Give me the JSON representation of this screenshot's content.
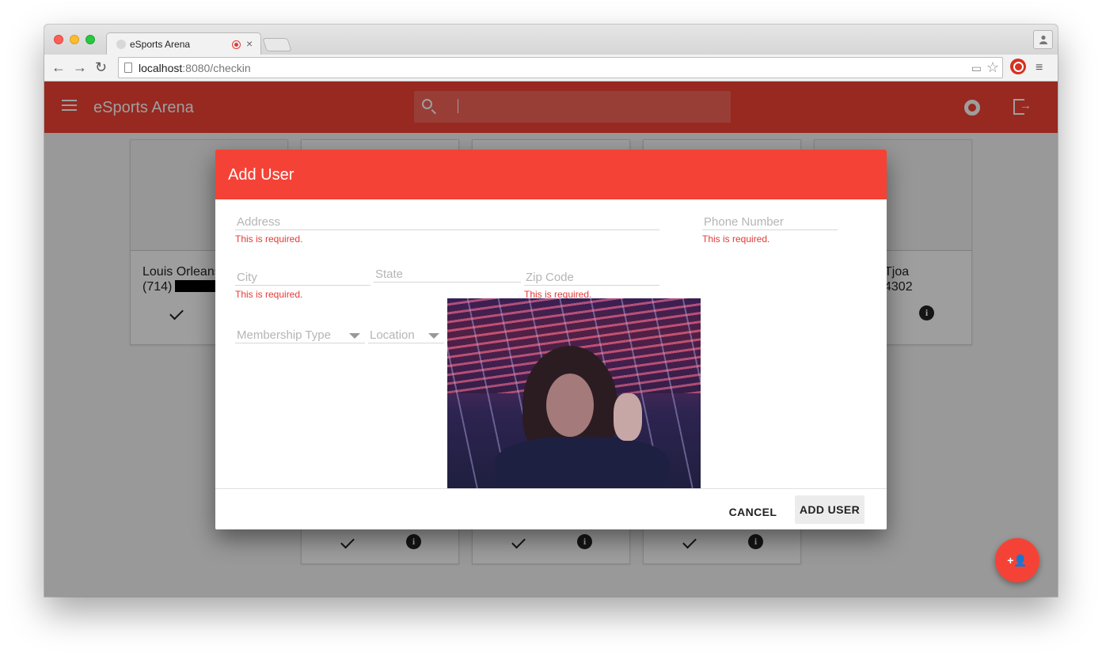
{
  "browser": {
    "tab_title": "eSports Arena",
    "url_host": "localhost",
    "url_path": ":8080/checkin"
  },
  "appbar": {
    "title": "eSports Arena",
    "search_value": ""
  },
  "cards": [
    {
      "name": "Louis Orleans",
      "phone": "(714)"
    },
    {
      "name": "Tjoa",
      "phone": "4302"
    }
  ],
  "dialog": {
    "title": "Add User",
    "fields": {
      "address": {
        "label": "Address",
        "error": "This is required."
      },
      "phone": {
        "label": "Phone Number",
        "error": "This is required."
      },
      "city": {
        "label": "City",
        "error": "This is required."
      },
      "state": {
        "label": "State"
      },
      "zip": {
        "label": "Zip Code",
        "error": "This is required."
      },
      "membership": {
        "label": "Membership Type"
      },
      "location": {
        "label": "Location"
      }
    },
    "cancel_label": "CANCEL",
    "add_label": "ADD USER"
  },
  "colors": {
    "primary": "#f44336",
    "error": "#e53935"
  }
}
